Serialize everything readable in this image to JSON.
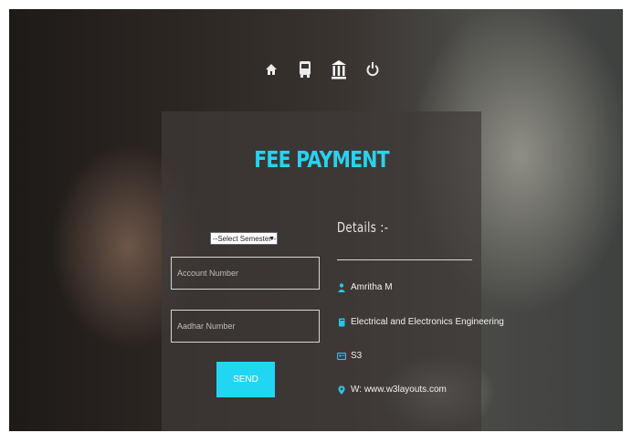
{
  "nav": {
    "items": [
      {
        "icon": "home-icon"
      },
      {
        "icon": "bus-icon"
      },
      {
        "icon": "bank-icon"
      },
      {
        "icon": "power-icon"
      }
    ]
  },
  "form": {
    "title": "FEE PAYMENT",
    "semester_select": "--Select Semester--",
    "account_placeholder": "Account Number",
    "aadhar_placeholder": "Aadhar Number",
    "send_label": "SEND"
  },
  "details": {
    "heading": "Details :-",
    "name": "Amritha M",
    "department": "Electrical and Electronics Engineering",
    "semester": "S3",
    "website": "W: www.w3layouts.com"
  },
  "colors": {
    "accent": "#21d6f2",
    "panel": "#3e3a39"
  }
}
